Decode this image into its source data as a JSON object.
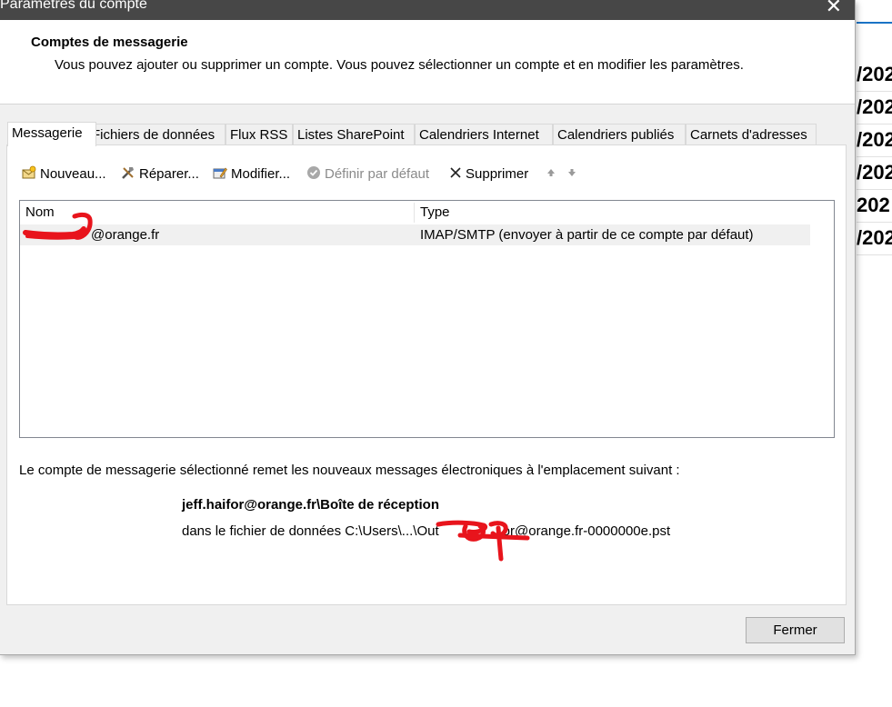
{
  "window": {
    "title": "Paramètres du compte",
    "close_glyph": "✕"
  },
  "header": {
    "title": "Comptes de messagerie",
    "description": "Vous pouvez ajouter ou supprimer un compte. Vous pouvez sélectionner un compte et en modifier les paramètres."
  },
  "tabs": [
    {
      "label": "Messagerie",
      "active": true
    },
    {
      "label": "Fichiers de données"
    },
    {
      "label": "Flux RSS"
    },
    {
      "label": "Listes SharePoint"
    },
    {
      "label": "Calendriers Internet"
    },
    {
      "label": "Calendriers publiés"
    },
    {
      "label": "Carnets d'adresses"
    }
  ],
  "toolbar": {
    "new": "Nouveau...",
    "repair": "Réparer...",
    "modify": "Modifier...",
    "set_default": "Définir par défaut",
    "delete": "Supprimer",
    "move_up_icon": "arrow-up-icon",
    "move_down_icon": "arrow-down-icon"
  },
  "accounts_list": {
    "columns": [
      "Nom",
      "Type"
    ],
    "rows": [
      {
        "name": "jeff.haifor@orange.fr",
        "name_visible": "@orange.fr",
        "type": "IMAP/SMTP (envoyer à partir de ce compte par défaut)"
      }
    ]
  },
  "delivery": {
    "intro": "Le compte de messagerie sélectionné remet les nouveaux messages électroniques à l'emplacement suivant :",
    "location": "jeff.haifor@orange.fr\\Boîte de réception",
    "file_prefix": "dans le fichier de données C:\\Users\\...\\Out",
    "file_suffix": "or@orange.fr-0000000e.pst"
  },
  "buttons": {
    "close": "Fermer"
  },
  "background_app": {
    "rows": [
      "/202",
      "/202",
      "/202",
      "/202",
      "202",
      "/202"
    ]
  },
  "colors": {
    "titlebar": "#474747",
    "dialog_bg": "#f0f0f0",
    "redaction": "#e8141c",
    "accent": "#1a73c5"
  }
}
